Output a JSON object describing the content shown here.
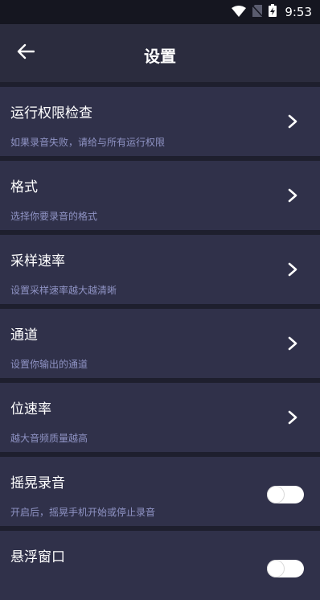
{
  "status_bar": {
    "time": "9:53",
    "icons": [
      "wifi-icon",
      "no-sim-icon",
      "battery-charging-icon"
    ]
  },
  "header": {
    "back_icon": "arrow-left-icon",
    "title": "设置"
  },
  "settings": [
    {
      "title": "运行权限检查",
      "subtitle": "如果录音失败，请给与所有运行权限",
      "control": "chevron"
    },
    {
      "title": "格式",
      "subtitle": "选择你要录音的格式",
      "control": "chevron"
    },
    {
      "title": "采样速率",
      "subtitle": "设置采样速率越大越清晰",
      "control": "chevron"
    },
    {
      "title": "通道",
      "subtitle": "设置你输出的通道",
      "control": "chevron"
    },
    {
      "title": "位速率",
      "subtitle": "越大音频质量越高",
      "control": "chevron"
    },
    {
      "title": "摇晃录音",
      "subtitle": "开启后，摇晃手机开始或停止录音",
      "control": "toggle",
      "on": false
    },
    {
      "title": "悬浮窗口",
      "subtitle": "",
      "control": "toggle",
      "on": false
    }
  ],
  "colors": {
    "background": "#1e1f2e",
    "app_bar": "#2b2c3e",
    "row": "#30314a",
    "subtitle": "#8f93c4",
    "toggle_track": "#ffffff"
  }
}
